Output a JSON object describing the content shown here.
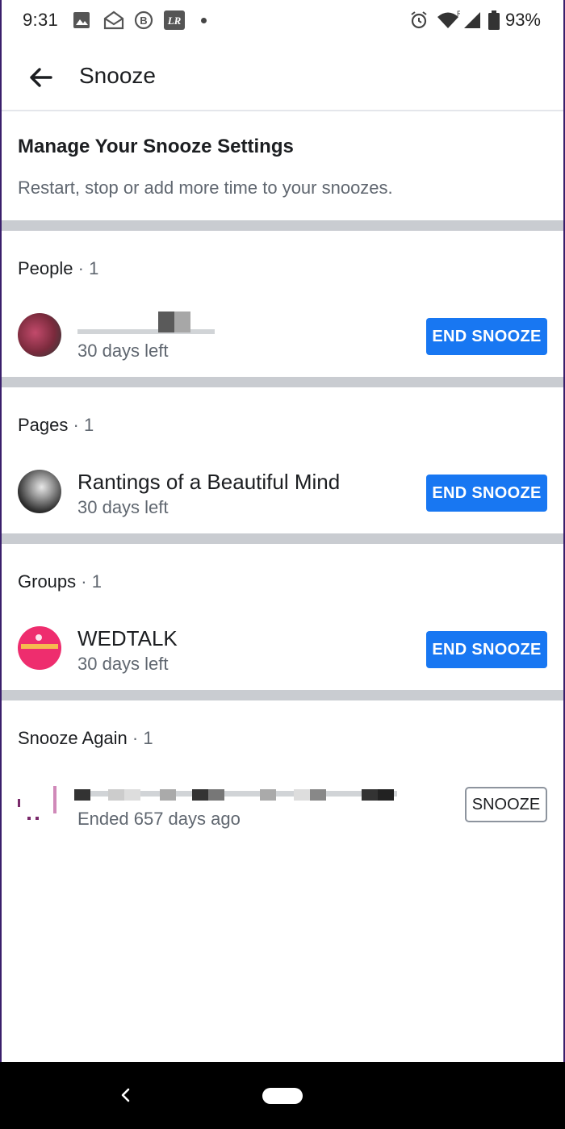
{
  "status_bar": {
    "time": "9:31",
    "battery": "93%",
    "icons": [
      "image-icon",
      "mail-open-icon",
      "b-badge-icon",
      "lr-app-icon",
      "alarm-icon",
      "wifi-icon",
      "signal-icon",
      "battery-icon"
    ]
  },
  "app_bar": {
    "title": "Snooze",
    "back_icon": "arrow-left-icon"
  },
  "header": {
    "title": "Manage Your Snooze Settings",
    "subtitle": "Restart, stop or add more time to your snoozes."
  },
  "sections": [
    {
      "label": "People",
      "count": "· 1",
      "item": {
        "name": "",
        "subtitle": "30 days left",
        "button": "END SNOOZE"
      }
    },
    {
      "label": "Pages",
      "count": "· 1",
      "item": {
        "name": "Rantings of a Beautiful Mind",
        "subtitle": "30 days left",
        "button": "END SNOOZE"
      }
    },
    {
      "label": "Groups",
      "count": "· 1",
      "item": {
        "name": "WEDTALK",
        "subtitle": "30 days left",
        "button": "END SNOOZE"
      }
    },
    {
      "label": "Snooze Again",
      "count": "· 1",
      "item": {
        "name": "",
        "subtitle": "Ended 657 days ago",
        "button": "SNOOZE"
      }
    }
  ],
  "colors": {
    "primary_button": "#1877f2",
    "divider": "#c9ccd1",
    "secondary_text": "#606770"
  },
  "nav_bar": {
    "icons": [
      "nav-back-icon",
      "nav-home-pill"
    ]
  }
}
